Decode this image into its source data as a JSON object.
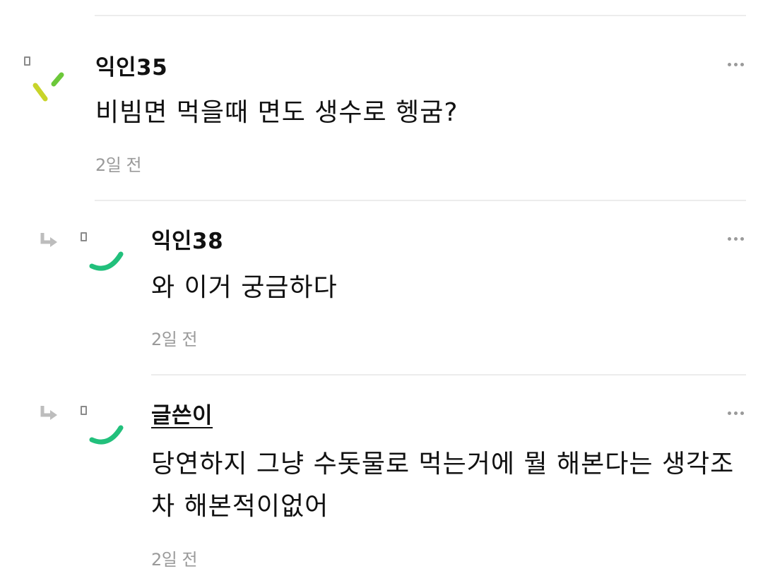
{
  "comments": [
    {
      "author": "익인35",
      "text": "비빔면 먹을때 면도 생수로 헹굼?",
      "time": "2일 전",
      "avatar_colors": [
        "#c8d42a",
        "#6cc83a"
      ],
      "is_reply": false,
      "is_op": false
    },
    {
      "author": "익인38",
      "text": "와 이거 궁금하다",
      "time": "2일 전",
      "avatar_colors": [
        "#22c07c"
      ],
      "is_reply": true,
      "is_op": false
    },
    {
      "author": "글쓴이",
      "text": "당연하지 그냥 수돗물로 먹는거에 뭘 해본다는 생각조차 해본적이없어",
      "time": "2일 전",
      "avatar_colors": [
        "#22c07c"
      ],
      "is_reply": true,
      "is_op": true
    }
  ],
  "icons": {
    "more": "more-dots-icon",
    "reply": "reply-arrow-icon",
    "avatar_tag": "tag-icon"
  }
}
